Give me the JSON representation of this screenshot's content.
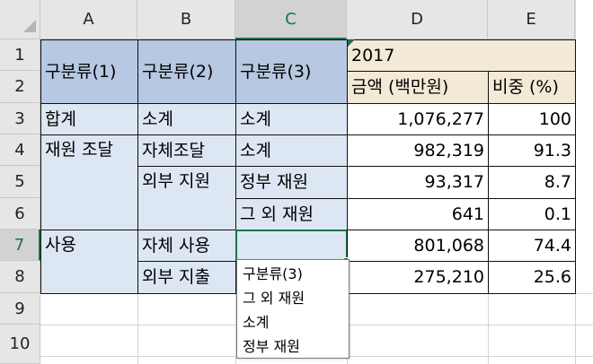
{
  "columns": [
    "A",
    "B",
    "C",
    "D",
    "E"
  ],
  "rows": [
    "1",
    "2",
    "3",
    "4",
    "5",
    "6",
    "7",
    "8",
    "9",
    "10"
  ],
  "header": {
    "col1": "구분류(1)",
    "col2": "구분류(2)",
    "col3": "구분류(3)",
    "year": "2017",
    "amount": "금액 (백만원)",
    "ratio": "비중 (%)"
  },
  "cells": {
    "A3": "합계",
    "B3": "소계",
    "C3": "소계",
    "D3": "1,076,277",
    "E3": "100",
    "A4": "재원 조달",
    "B4": "자체조달",
    "C4": "소계",
    "D4": "982,319",
    "E4": "91.3",
    "B5": "외부 지원",
    "C5": "정부 재원",
    "D5": "93,317",
    "E5": "8.7",
    "C6": "그 외 재원",
    "D6": "641",
    "E6": "0.1",
    "A7": "사용",
    "B7": "자체 사용",
    "C7": "",
    "D7": "801,068",
    "E7": "74.4",
    "B8": "외부 지출",
    "D8": "275,210",
    "E8": "25.6"
  },
  "dropdown": {
    "options": [
      "구분류(3)",
      "그 외 재원",
      "소계",
      "정부 재원"
    ]
  },
  "colors": {
    "header_blue": "#b7c8e2",
    "light_blue": "#dde7f4",
    "tan": "#f2ead6",
    "selection_green": "#1e7145"
  }
}
